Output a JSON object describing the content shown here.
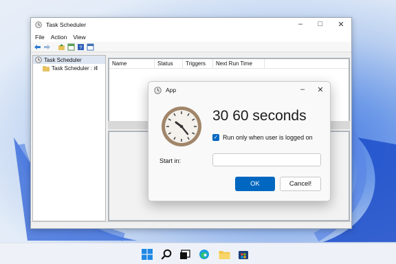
{
  "main_window": {
    "title": "Task Scheduler",
    "menu": [
      "File",
      "Action",
      "View"
    ],
    "tree": [
      {
        "label": "Task Scheduler",
        "selected": true
      },
      {
        "label": "Task Scheduler : i¢",
        "selected": false
      }
    ],
    "columns": [
      "Name",
      "Status",
      "Triggers",
      "Next Run Time"
    ]
  },
  "dialog": {
    "title": "App",
    "heading": "30 60 seconds",
    "checkbox_label": "Run only when user is logged on",
    "checkbox_checked": true,
    "start_in_label": "Start in:",
    "start_in_value": "",
    "ok_label": "OK",
    "cancel_label": "Cancel!"
  },
  "colors": {
    "accent": "#0067c0"
  },
  "taskbar": {
    "icons": [
      "start-icon",
      "search-icon",
      "task-view-icon",
      "edge-icon",
      "file-explorer-icon",
      "store-icon"
    ]
  }
}
